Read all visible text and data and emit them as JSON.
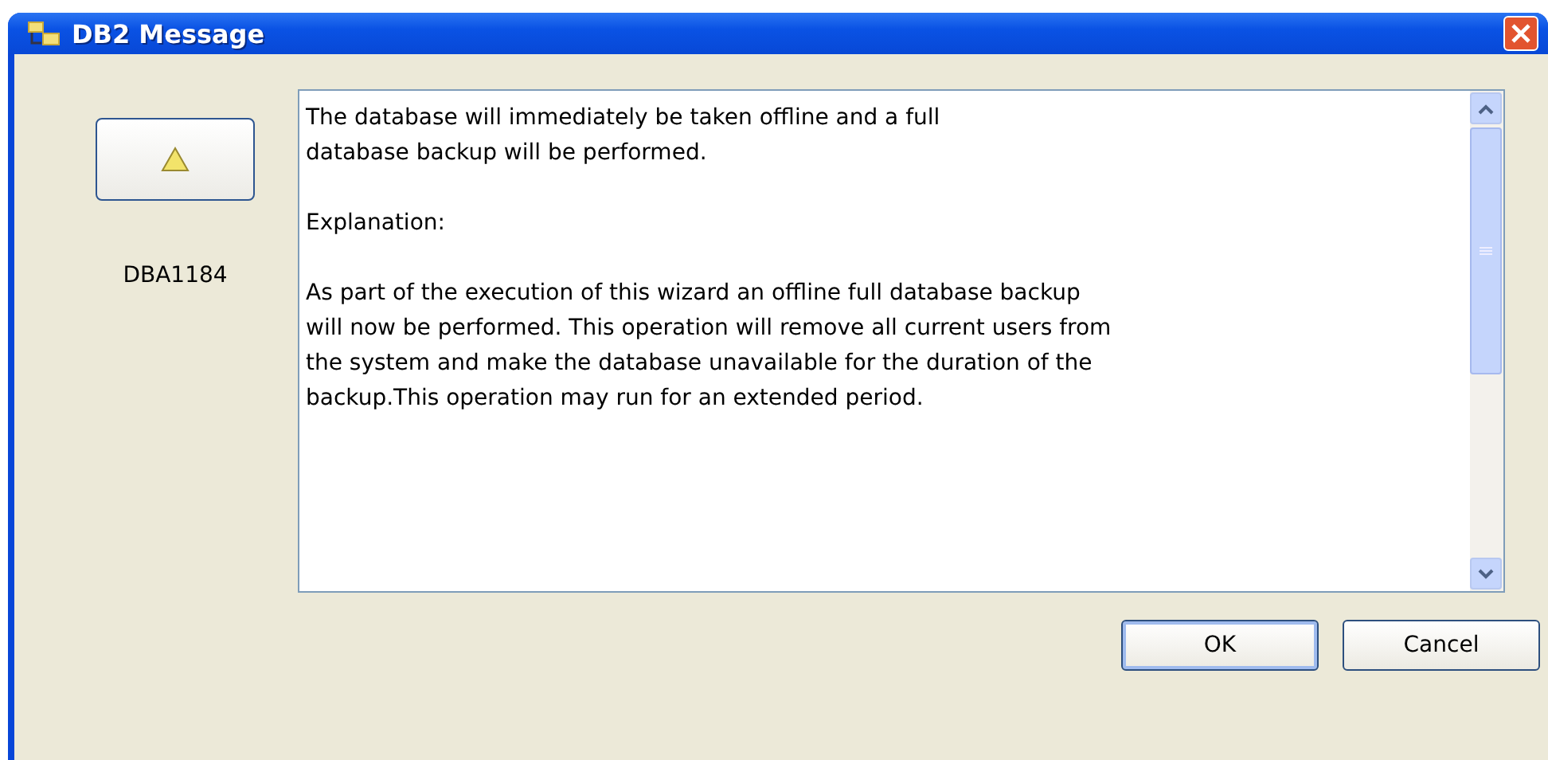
{
  "window": {
    "title": "DB2 Message"
  },
  "message": {
    "code": "DBA1184",
    "paragraphs": [
      [
        "The database will immediately be taken offline and a full",
        "database backup will be performed."
      ],
      [
        "Explanation:"
      ],
      [
        "As part of the execution of this wizard an offline full database backup",
        "will now be performed. This operation will remove all current users from",
        "the system and make the database unavailable for the duration of the",
        "backup.This operation may run for an extended period."
      ]
    ]
  },
  "buttons": [
    {
      "label": "OK",
      "default": true
    },
    {
      "label": "Cancel",
      "default": false
    }
  ]
}
